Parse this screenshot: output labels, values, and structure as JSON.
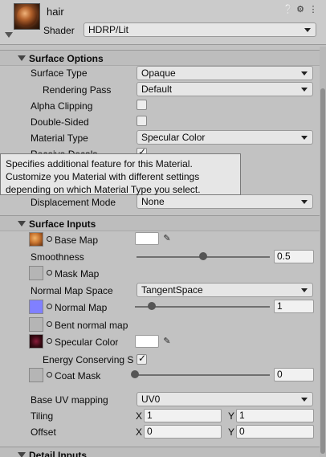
{
  "header": {
    "material_name": "hair",
    "shader_label": "Shader",
    "shader_value": "HDRP/Lit",
    "icons": [
      "help-icon",
      "settings-sliders-icon",
      "more-options-icon"
    ]
  },
  "surface_options": {
    "title": "Surface Options",
    "surface_type": {
      "label": "Surface Type",
      "value": "Opaque"
    },
    "rendering_pass": {
      "label": "Rendering Pass",
      "value": "Default"
    },
    "alpha_clipping": {
      "label": "Alpha Clipping",
      "checked": false
    },
    "double_sided": {
      "label": "Double-Sided",
      "checked": false
    },
    "material_type": {
      "label": "Material Type",
      "value": "Specular Color"
    },
    "receive_decals": {
      "label": "Receive Decals",
      "checked": true
    },
    "displacement_mode": {
      "label": "Displacement Mode",
      "value": "None"
    }
  },
  "tooltip": {
    "line1": "Specifies additional feature for this Material.",
    "line2": "Customize you Material with different settings",
    "line3": "depending on which Material Type you select."
  },
  "surface_inputs": {
    "title": "Surface Inputs",
    "base_map": {
      "label": "Base Map",
      "color": "#ffffff"
    },
    "smoothness": {
      "label": "Smoothness",
      "value": "0.5",
      "fraction": 0.5
    },
    "mask_map": {
      "label": "Mask Map"
    },
    "normal_map_space": {
      "label": "Normal Map Space",
      "value": "TangentSpace"
    },
    "normal_map": {
      "label": "Normal Map",
      "value": "1",
      "fraction": 0.125
    },
    "bent_normal_map": {
      "label": "Bent normal map"
    },
    "specular_color": {
      "label": "Specular Color",
      "color": "#ffffff"
    },
    "energy_conserving": {
      "label": "Energy Conserving S",
      "checked": true
    },
    "coat_mask": {
      "label": "Coat Mask",
      "value": "0",
      "fraction": 0.0
    },
    "base_uv_mapping": {
      "label": "Base UV mapping",
      "value": "UV0"
    },
    "tiling": {
      "label": "Tiling",
      "x_label": "X",
      "x": "1",
      "y_label": "Y",
      "y": "1"
    },
    "offset": {
      "label": "Offset",
      "x_label": "X",
      "x": "0",
      "y_label": "Y",
      "y": "0"
    }
  },
  "detail_inputs": {
    "title": "Detail Inputs"
  },
  "colors": {
    "normal_map_swatch": "#8080ff",
    "base_map_thumb": "#c8742f",
    "specular_thumb": "#3a0a14"
  }
}
